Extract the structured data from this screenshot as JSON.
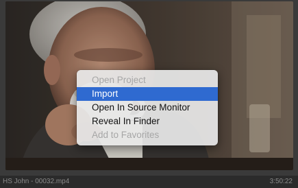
{
  "clip": {
    "name": "HS John - 00032.mp4",
    "duration": "3:50:22"
  },
  "context_menu": {
    "items": [
      {
        "label": "Open Project",
        "enabled": false,
        "selected": false
      },
      {
        "label": "Import",
        "enabled": true,
        "selected": true
      },
      {
        "label": "Open In Source Monitor",
        "enabled": true,
        "selected": false
      },
      {
        "label": "Reveal In Finder",
        "enabled": true,
        "selected": false
      },
      {
        "label": "Add to Favorites",
        "enabled": false,
        "selected": false
      }
    ]
  },
  "colors": {
    "panel_background": "#2b2b2b",
    "menu_background": "#e8e8e8",
    "menu_selection": "#2f6ad0",
    "disabled_text": "#a6a6a6",
    "caption_text": "#8a8a8a"
  }
}
